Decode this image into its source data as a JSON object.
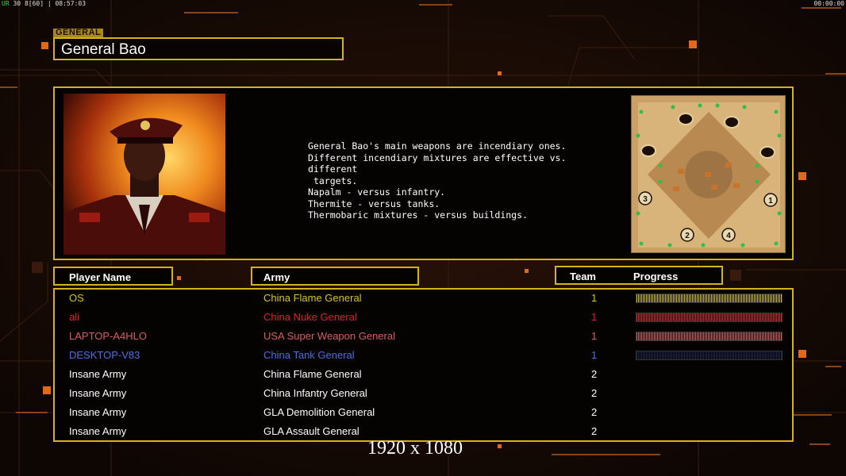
{
  "overlay": {
    "fps_label": "UR",
    "fps_a": "30",
    "fps_b": "8",
    "fps_c": "[60]",
    "time_left": "08:57:03",
    "time_right": "00:00:00"
  },
  "header": {
    "tag": "GENERAL",
    "title": "General Bao"
  },
  "general": {
    "description": "General Bao's main weapons are incendiary ones.\nDifferent incendiary mixtures are effective vs. different\n targets.\nNapalm - versus infantry.\nThermite - versus tanks.\nThermobaric mixtures - versus buildings."
  },
  "minimap": {
    "start_positions": [
      "1",
      "2",
      "3",
      "4"
    ]
  },
  "columns": {
    "player": "Player Name",
    "army": "Army",
    "team": "Team",
    "progress": "Progress"
  },
  "players": [
    {
      "name": "OS",
      "army": "China Flame General",
      "team": "1",
      "color": "#d7c519",
      "progress": 1.0
    },
    {
      "name": "ali",
      "army": "China Nuke General",
      "team": "1",
      "color": "#e0201b",
      "progress": 1.0
    },
    {
      "name": "LAPTOP-A4HLO",
      "army": "USA Super Weapon General",
      "team": "1",
      "color": "#d85d5d",
      "progress": 1.0
    },
    {
      "name": "DESKTOP-V83",
      "army": "China Tank General",
      "team": "1",
      "color": "#4a6fe3",
      "progress": 0.0
    },
    {
      "name": "Insane Army",
      "army": "China Flame General",
      "team": "2",
      "color": "#ffffff"
    },
    {
      "name": "Insane Army",
      "army": "China Infantry General",
      "team": "2",
      "color": "#ffffff"
    },
    {
      "name": "Insane Army",
      "army": "GLA Demolition General",
      "team": "2",
      "color": "#ffffff"
    },
    {
      "name": "Insane Army",
      "army": "GLA Assault General",
      "team": "2",
      "color": "#ffffff"
    }
  ],
  "resolution_label": "1920 x 1080"
}
